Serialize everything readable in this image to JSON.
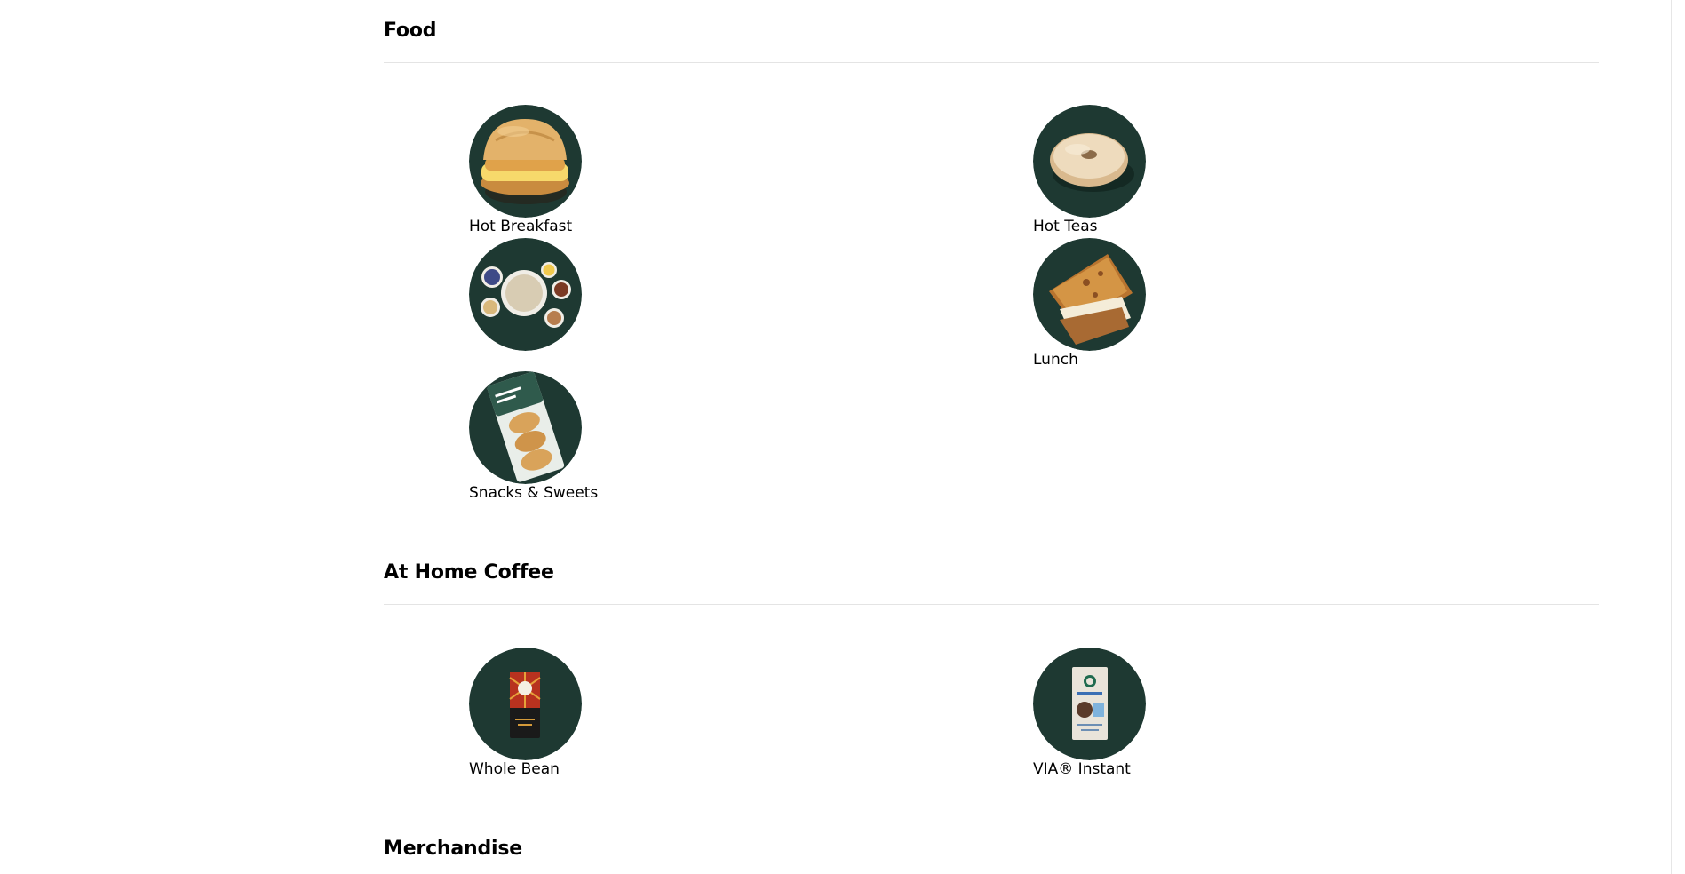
{
  "colors": {
    "circle_bg": "#1e3932",
    "divider": "#e4e4e4",
    "text": "#000000"
  },
  "sections": {
    "food": {
      "title": "Food",
      "items": [
        {
          "label": "Hot Breakfast",
          "icon": "breakfast-sandwich-icon"
        },
        {
          "label": "Hot Teas",
          "icon": "bagel-icon"
        },
        {
          "label": "",
          "icon": "oatmeal-bowls-icon"
        },
        {
          "label": "Lunch",
          "icon": "grilled-sandwich-icon"
        },
        {
          "label": "Snacks & Sweets",
          "icon": "madeleines-pack-icon"
        }
      ]
    },
    "at_home_coffee": {
      "title": "At Home Coffee",
      "items": [
        {
          "label": "Whole Bean",
          "icon": "coffee-bag-icon"
        },
        {
          "label": "VIA® Instant",
          "icon": "via-instant-box-icon"
        }
      ]
    },
    "merchandise": {
      "title": "Merchandise"
    }
  }
}
